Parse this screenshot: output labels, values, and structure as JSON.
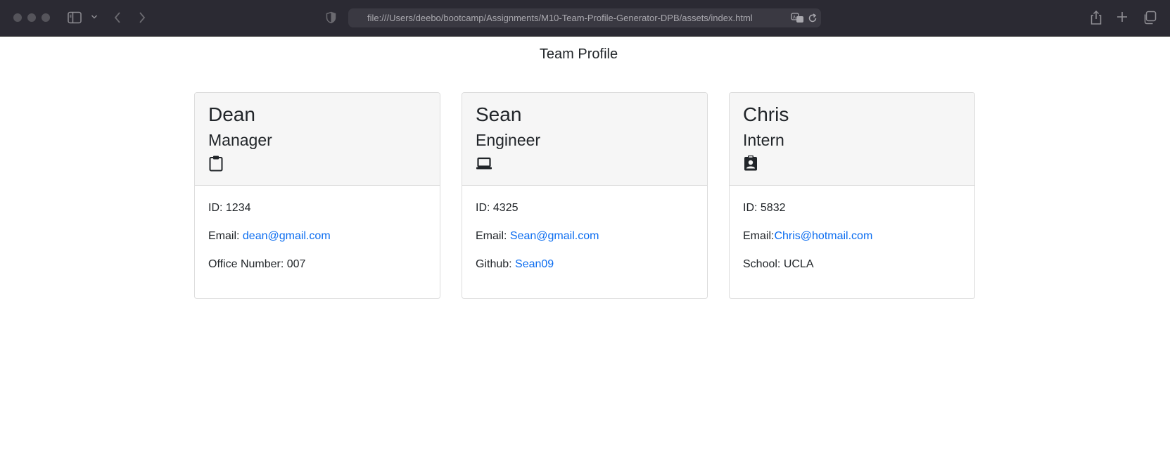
{
  "browser": {
    "url": "file:///Users/deebo/bootcamp/Assignments/M10-Team-Profile-Generator-DPB/assets/index.html"
  },
  "page": {
    "title": "Team Profile"
  },
  "cards": [
    {
      "name": "Dean",
      "role": "Manager",
      "icon": "clipboard-icon",
      "id_label": "ID: 1234",
      "email_label": "Email: ",
      "email": "dean@gmail.com",
      "extra_label": "Office Number: 007",
      "extra_link": ""
    },
    {
      "name": "Sean",
      "role": "Engineer",
      "icon": "laptop-icon",
      "id_label": "ID: 4325",
      "email_label": "Email: ",
      "email": "Sean@gmail.com",
      "extra_label": "Github: ",
      "extra_link": "Sean09"
    },
    {
      "name": "Chris",
      "role": "Intern",
      "icon": "id-badge-icon",
      "id_label": "ID: 5832",
      "email_label": "Email:",
      "email": "Chris@hotmail.com",
      "extra_label": "School: UCLA",
      "extra_link": ""
    }
  ],
  "colors": {
    "link": "#0a6cf0",
    "toolbar": "#2b2a33",
    "card_header": "#f6f6f6"
  }
}
